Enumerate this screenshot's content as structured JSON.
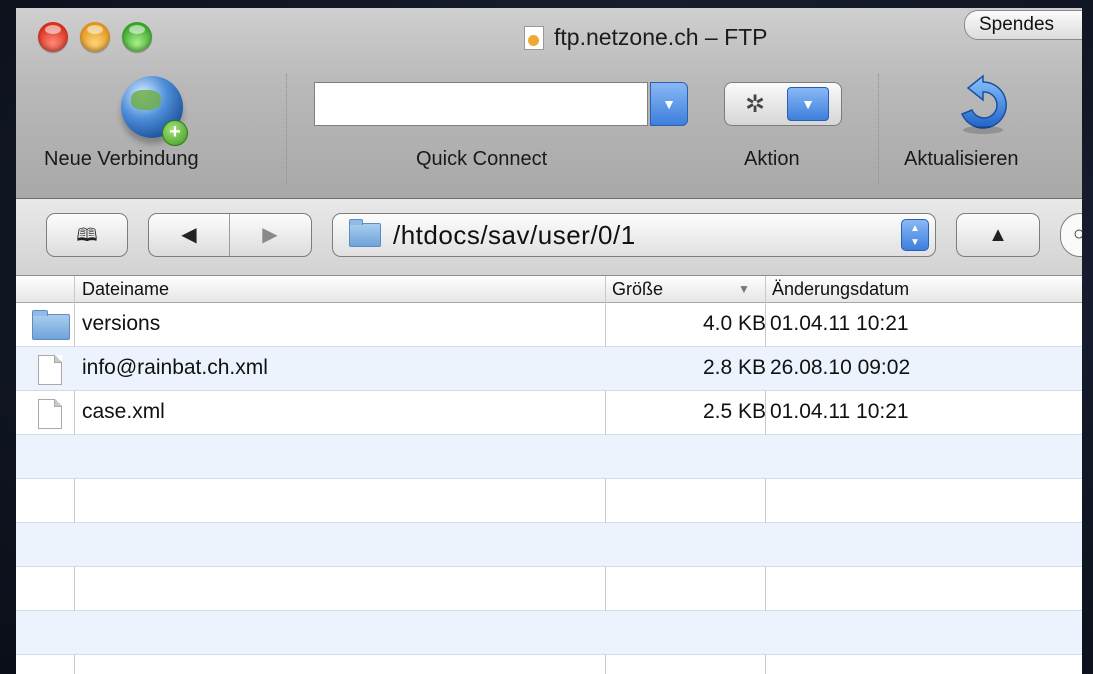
{
  "window": {
    "title": "ftp.netzone.ch – FTP",
    "donate_label": "Spendes"
  },
  "toolbar": {
    "new_connection_label": "Neue Verbindung",
    "quick_connect_label": "Quick Connect",
    "quick_connect_value": "",
    "action_label": "Aktion",
    "refresh_label": "Aktualisieren"
  },
  "navbar": {
    "back_glyph": "◀",
    "forward_glyph": "▶",
    "up_glyph": "▲",
    "bookmark_glyph": "📖",
    "path": "/htdocs/sav/user/0/1"
  },
  "table": {
    "columns": {
      "name": "Dateiname",
      "size": "Größe",
      "date": "Änderungsdatum"
    },
    "rows": [
      {
        "name": "versions",
        "size": "4.0 KB",
        "date": "01.04.11 10:21",
        "icon": "folder-icon"
      },
      {
        "name": "info@rainbat.ch.xml",
        "size": "2.8 KB",
        "date": "26.08.10 09:02",
        "icon": "file-icon"
      },
      {
        "name": "case.xml",
        "size": "2.5 KB",
        "date": "01.04.11 10:21",
        "icon": "file-icon"
      }
    ]
  },
  "colors": {
    "toolbar_bg": "#b9b9b9",
    "row_alt": "#edf3fd",
    "accent_blue": "#3c7fdc"
  }
}
